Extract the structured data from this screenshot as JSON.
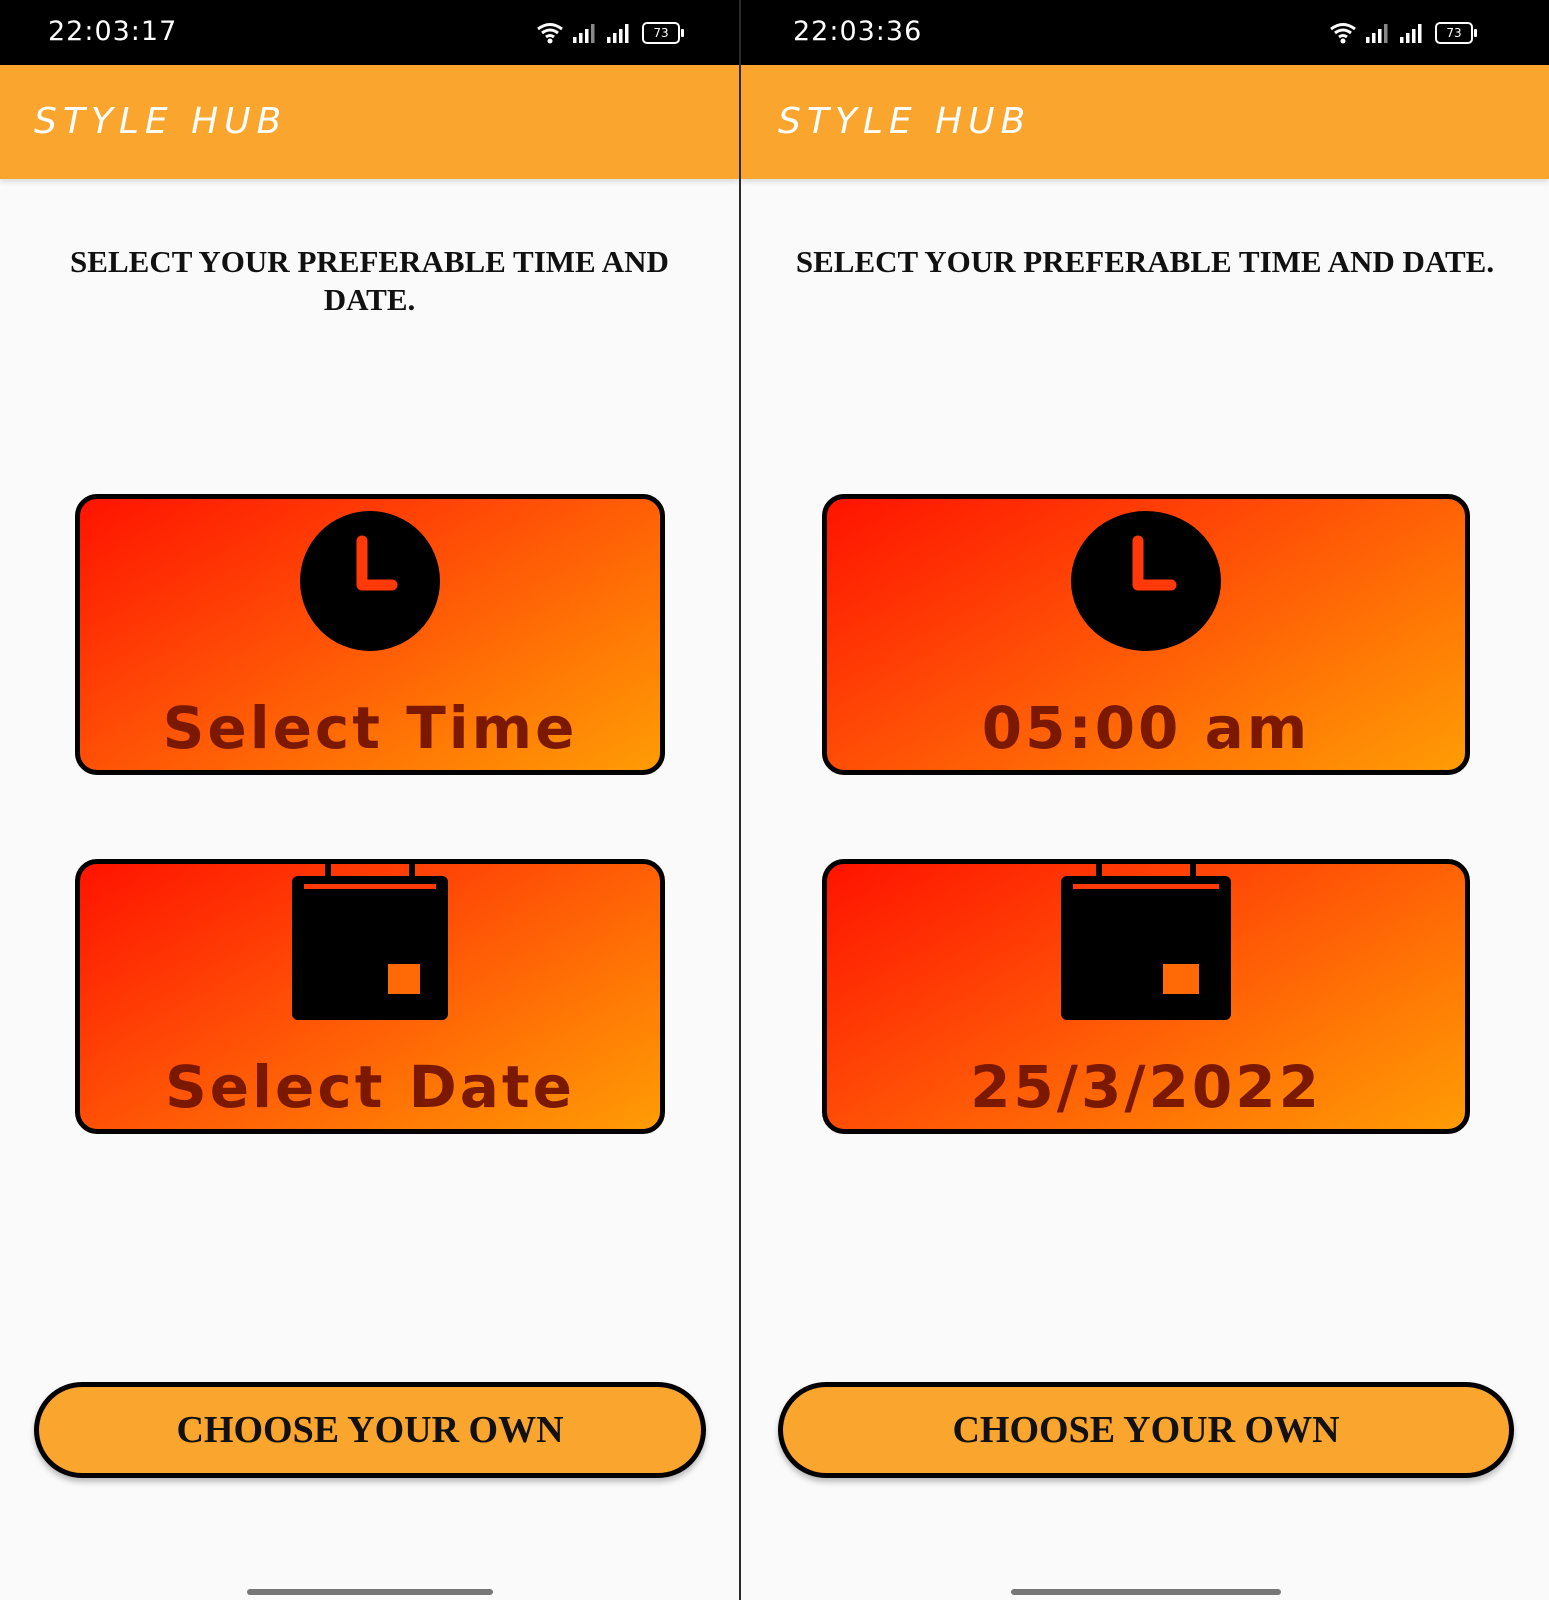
{
  "screens": [
    {
      "status_bar": {
        "time": "22:03:17",
        "battery": "73"
      },
      "app_bar": {
        "title": "STYLE HUB"
      },
      "heading": "SELECT YOUR PREFERABLE TIME AND DATE.",
      "time_card": {
        "label": "Select Time",
        "icon": "clock-icon"
      },
      "date_card": {
        "label": "Select Date",
        "icon": "calendar-icon"
      },
      "choose_button": {
        "label": "CHOOSE YOUR OWN"
      }
    },
    {
      "status_bar": {
        "time": "22:03:36",
        "battery": "73"
      },
      "app_bar": {
        "title": "STYLE HUB"
      },
      "heading": "SELECT YOUR PREFERABLE TIME AND DATE.",
      "time_card": {
        "label": "05:00 am",
        "icon": "clock-icon"
      },
      "date_card": {
        "label": "25/3/2022",
        "icon": "calendar-icon"
      },
      "choose_button": {
        "label": "CHOOSE YOUR OWN"
      }
    }
  ],
  "colors": {
    "status_bar": "#000000",
    "app_bar": "#f9a52e",
    "card_gradient_start": "#ff1300",
    "card_gradient_end": "#ff9c05",
    "card_text": "#7a1900",
    "button": "#f9a52e"
  }
}
